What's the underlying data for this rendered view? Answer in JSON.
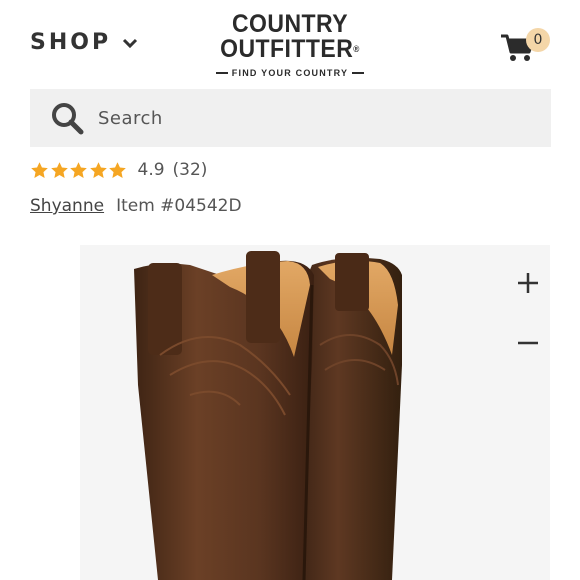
{
  "header": {
    "shop_label": "SHOP",
    "logo_line1": "COUNTRY",
    "logo_line2": "OUTFITTER",
    "logo_tagline": "FIND YOUR COUNTRY",
    "cart_count": "0",
    "icons": [
      "chevron-down-icon",
      "cart-icon"
    ]
  },
  "search": {
    "placeholder": "Search",
    "value": "",
    "icon": "search-icon"
  },
  "product": {
    "rating_value": "4.9",
    "rating_count": "(32)",
    "stars_filled": 5,
    "brand": "Shyanne",
    "item_number": "Item #04542D"
  },
  "gallery": {
    "image": "brown-leather-cowboy-boots",
    "zoom_icons": [
      "plus-icon",
      "minus-icon"
    ]
  },
  "colors": {
    "star": "#f5a623",
    "badge": "#f4d6a8",
    "search_bg": "#f0f0f0",
    "boot_leather": "#5a3520",
    "boot_lining": "#d89a55"
  }
}
